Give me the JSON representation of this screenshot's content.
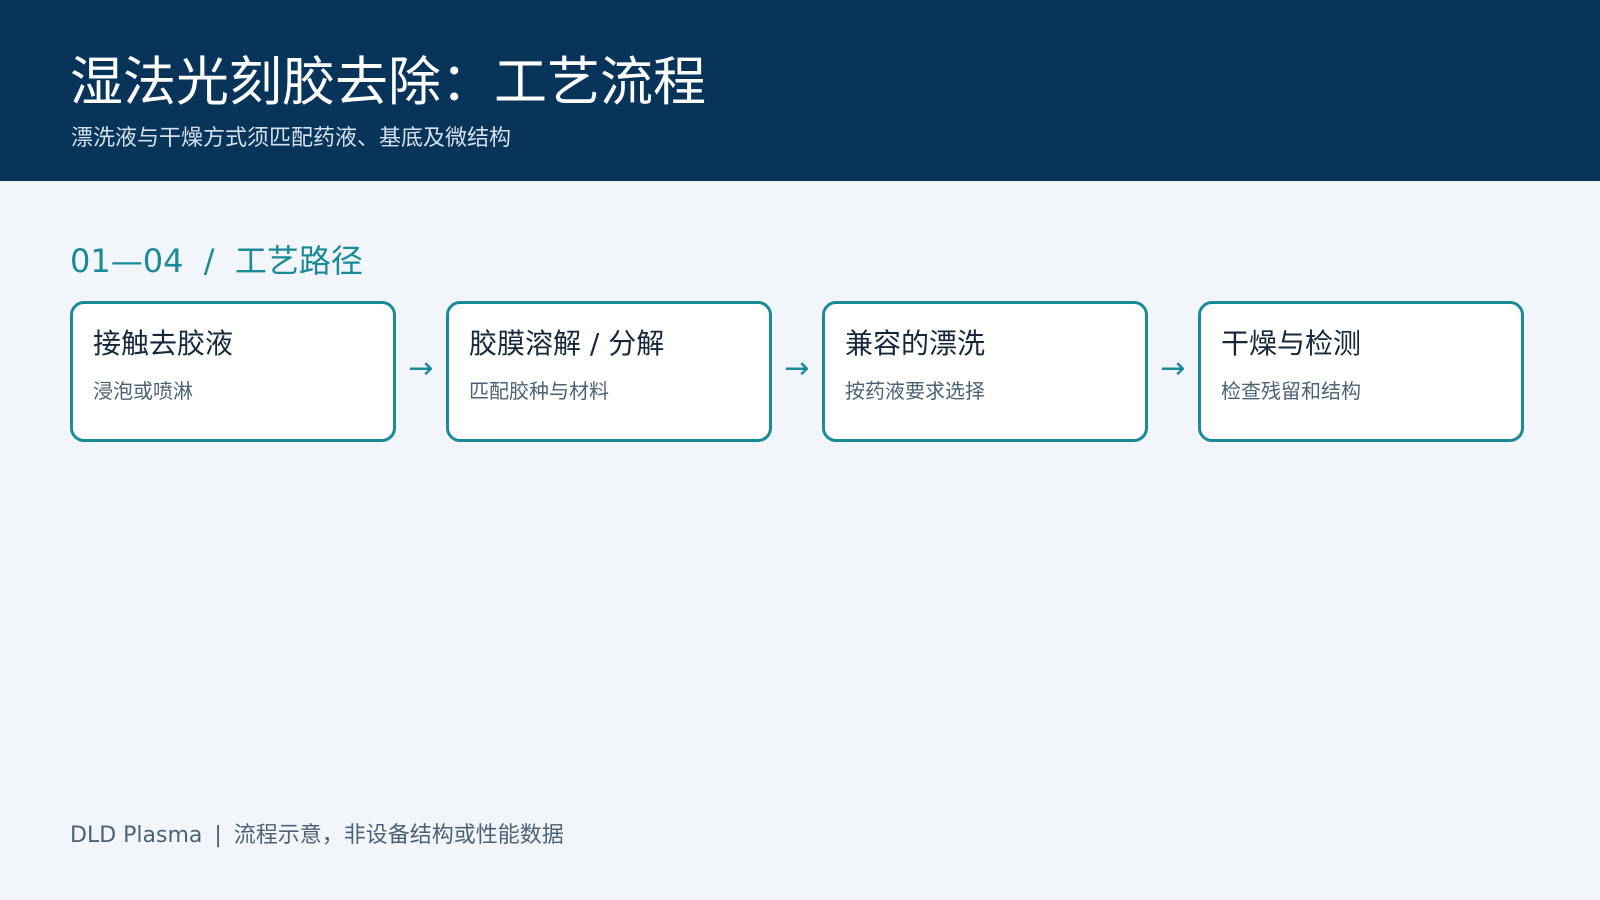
{
  "header": {
    "title": "湿法光刻胶去除：工艺流程",
    "subtitle": "漂洗液与干燥方式须匹配药液、基底及微结构"
  },
  "section": {
    "label": "01—04  /  工艺路径"
  },
  "flow": {
    "arrow_symbol": "→",
    "steps": [
      {
        "title": "接触去胶液",
        "subtitle": "浸泡或喷淋"
      },
      {
        "title": "胶膜溶解 / 分解",
        "subtitle": "匹配胶种与材料"
      },
      {
        "title": "兼容的漂洗",
        "subtitle": "按药液要求选择"
      },
      {
        "title": "干燥与检测",
        "subtitle": "检查残留和结构"
      }
    ]
  },
  "footer": {
    "brand": "DLD Plasma",
    "separator": "|",
    "note": "流程示意，非设备结构或性能数据"
  },
  "colors": {
    "header_bg": "#083459",
    "page_bg": "#f2f6fa",
    "accent_teal": "#1a8a96",
    "text_dark": "#17273a",
    "text_muted": "#4d6276"
  }
}
